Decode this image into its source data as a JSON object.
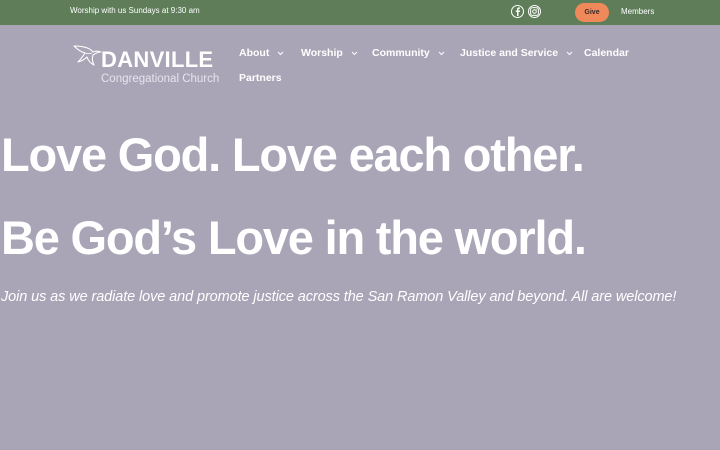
{
  "topbar": {
    "worship_text": "Worship with us Sundays at 9:30 am",
    "social": [
      {
        "icon": "facebook-icon"
      },
      {
        "icon": "instagram-icon"
      }
    ],
    "give_label": "Give",
    "members_label": "Members"
  },
  "logo": {
    "icon": "dove-icon",
    "name": "DANVILLE",
    "subtitle": "Congregational Church"
  },
  "nav": {
    "items": [
      {
        "label": "About",
        "has_dropdown": true
      },
      {
        "label": "Worship",
        "has_dropdown": true
      },
      {
        "label": "Community",
        "has_dropdown": true
      },
      {
        "label": "Justice and Service",
        "has_dropdown": true
      },
      {
        "label": "Calendar",
        "has_dropdown": false
      },
      {
        "label": "Partners",
        "has_dropdown": false
      }
    ]
  },
  "hero": {
    "headline_1": "Love God. Love each other.",
    "headline_2": "Be God’s Love in the world.",
    "tagline": "Join us as we radiate love and promote justice across the San Ramon Valley and beyond. All are welcome!"
  },
  "colors": {
    "topbar_bg": "#5e7d58",
    "page_bg": "#a9a5b6",
    "give_button": "#f0895a",
    "text": "#ffffff"
  }
}
